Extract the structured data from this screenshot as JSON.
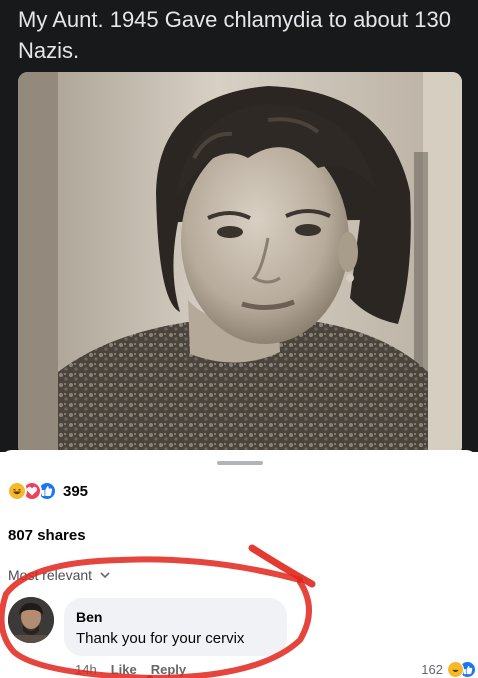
{
  "post": {
    "caption": "My Aunt.  1945  Gave chlamydia to about 130 Nazis."
  },
  "reactions": {
    "icons": [
      "haha-icon",
      "love-icon",
      "like-icon"
    ],
    "count": "395"
  },
  "shares": "807 shares",
  "sort": {
    "label": "Most relevant"
  },
  "comment": {
    "author": "Ben",
    "text": "Thank you for your cervix",
    "time": "14h",
    "like_label": "Like",
    "reply_label": "Reply",
    "reaction_count": "162"
  },
  "colors": {
    "header_bg": "#18191a",
    "header_text": "#e4e6eb",
    "like_blue": "#1877f2",
    "love_red": "#f33e58",
    "haha_yellow": "#f7b928",
    "markup_red": "#e0251b",
    "bubble_bg": "#f0f2f5"
  }
}
